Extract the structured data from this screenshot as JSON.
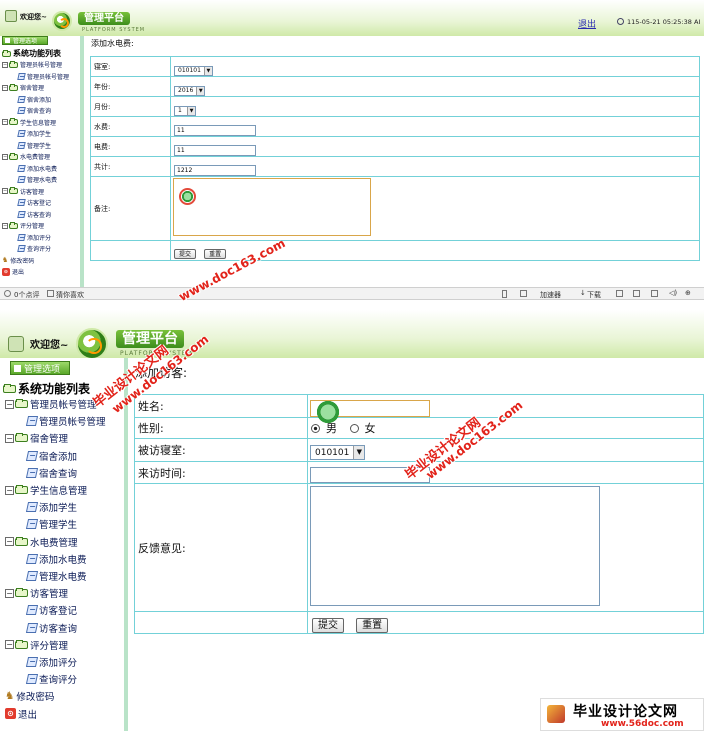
{
  "header": {
    "welcome": "欢迎您~",
    "brand": "管理平台",
    "brand_sub": "PLATFORM SYSTEM",
    "logout": "退出",
    "datetime": "115-05-21  05:25:38  AI"
  },
  "sidebar": {
    "options_label": "管理选项",
    "root": "系统功能列表",
    "groups": [
      {
        "label": "管理员帐号管理",
        "items": [
          "管理员帐号管理"
        ]
      },
      {
        "label": "宿舍管理",
        "items": [
          "宿舍添加",
          "宿舍查询"
        ]
      },
      {
        "label": "学生信息管理",
        "items": [
          "添加学生",
          "管理学生"
        ]
      },
      {
        "label": "水电费管理",
        "items": [
          "添加水电费",
          "管理水电费"
        ]
      },
      {
        "label": "访客管理",
        "items": [
          "访客登记",
          "访客查询"
        ]
      },
      {
        "label": "评分管理",
        "items": [
          "添加评分",
          "查询评分"
        ]
      }
    ],
    "change_password": "修改密码",
    "exit": "退出"
  },
  "utility_form": {
    "title": "添加水电费:",
    "labels": {
      "room": "寝室:",
      "year": "年份:",
      "month": "月份:",
      "water": "水费:",
      "electric": "电费:",
      "total": "共计:",
      "remark": "备注:"
    },
    "values": {
      "room": "010101",
      "year": "2016",
      "month": "1",
      "water": "11",
      "electric": "11",
      "total": "1212",
      "remark": ""
    },
    "submit": "提交",
    "reset": "重置"
  },
  "status_bar": {
    "comments": "0个点评",
    "guess": "猜你喜欢",
    "accelerator": "加速器",
    "download": "下载"
  },
  "visitor_form": {
    "title": "添加访客:",
    "labels": {
      "name": "姓名:",
      "gender": "性别:",
      "room": "被访寝室:",
      "time": "来访时间:",
      "feedback": "反馈意见:"
    },
    "gender_options": [
      "男",
      "女"
    ],
    "gender_selected": "男",
    "values": {
      "name": "",
      "room": "010101",
      "time": "",
      "feedback": ""
    },
    "submit": "提交",
    "reset": "重置"
  },
  "watermarks": {
    "cn": "毕业设计论文网",
    "url": "www.doc163.com",
    "badge_cn": "毕业设计论文网",
    "badge_url": "www.56doc.com"
  },
  "colors": {
    "accent_green": "#5aa82a",
    "table_border": "#73d1d8",
    "watermark_red": "#e2231a"
  }
}
